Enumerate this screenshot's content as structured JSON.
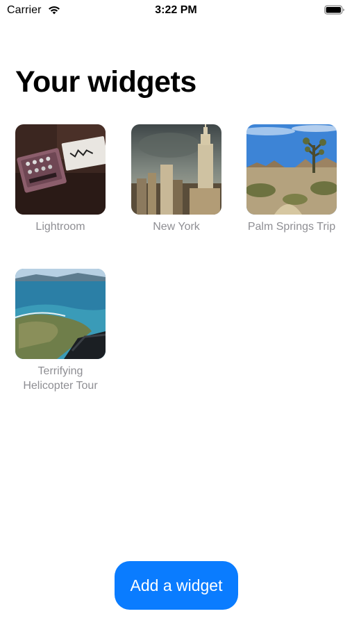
{
  "status_bar": {
    "carrier": "Carrier",
    "time": "3:22 PM",
    "icons": [
      "wifi-icon",
      "battery-icon"
    ]
  },
  "page": {
    "title": "Your widgets"
  },
  "widgets": [
    {
      "label": "Lightroom"
    },
    {
      "label": "New York"
    },
    {
      "label": "Palm Springs Trip"
    },
    {
      "label": "Terrifying Helicopter Tour"
    }
  ],
  "actions": {
    "add_label": "Add a widget"
  },
  "colors": {
    "accent": "#0a7cff",
    "label_gray": "#8e8e93"
  }
}
